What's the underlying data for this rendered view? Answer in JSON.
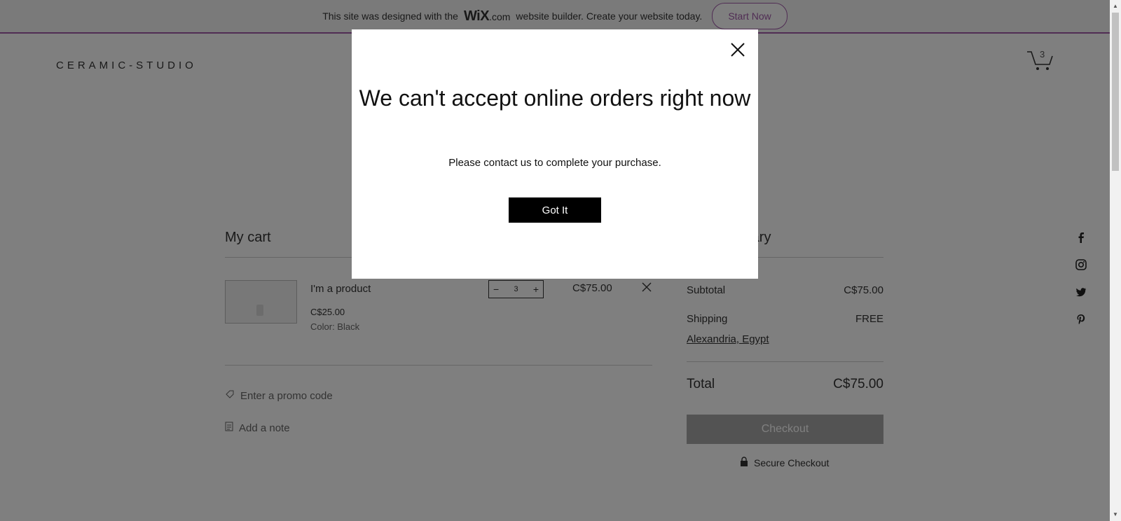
{
  "banner": {
    "text_before": "This site was designed with the",
    "logo": "WiX",
    "logo_suffix": ".com",
    "text_after": "website builder. Create your website today.",
    "cta": "Start Now"
  },
  "header": {
    "brand": "CERAMIC-STUDIO",
    "cart_count": "3"
  },
  "cart": {
    "title": "My cart",
    "item": {
      "name": "I'm a product",
      "price": "C$25.00",
      "option": "Color: Black",
      "quantity": "3",
      "total": "C$75.00"
    },
    "promo": "Enter a promo code",
    "note": "Add a note"
  },
  "summary": {
    "title_visible": "mary",
    "subtotal_label": "Subtotal",
    "subtotal_value": "C$75.00",
    "shipping_label": "Shipping",
    "shipping_value": "FREE",
    "location": "Alexandria, Egypt",
    "total_label": "Total",
    "total_value": "C$75.00",
    "checkout": "Checkout",
    "secure": "Secure Checkout"
  },
  "modal": {
    "title": "We can't accept online orders right now",
    "text": "Please contact us to complete your purchase.",
    "button": "Got It"
  },
  "colors": {
    "accent": "#a05aa9",
    "overlay": "rgba(0,0,0,0.5)",
    "checkout_disabled": "#a6a6a6"
  }
}
